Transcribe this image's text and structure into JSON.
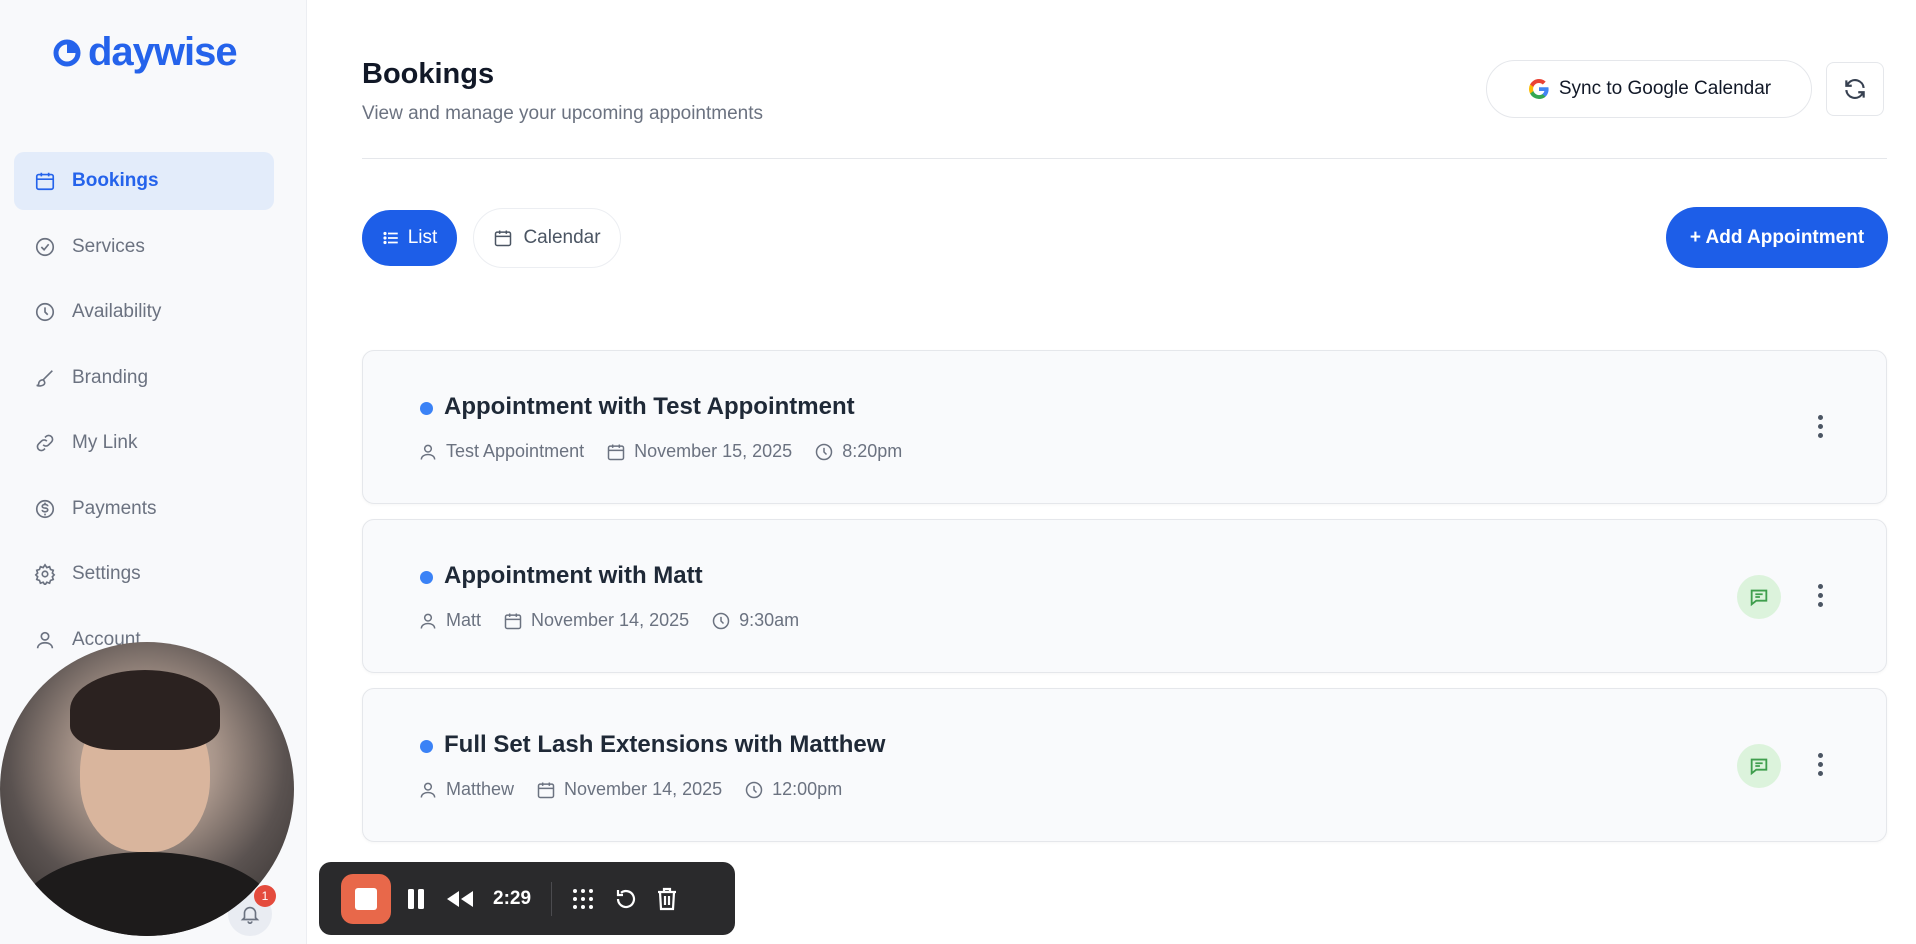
{
  "app": {
    "logo_text": "daywise"
  },
  "sidebar": {
    "items": [
      {
        "label": "Bookings",
        "icon": "calendar-icon",
        "active": true
      },
      {
        "label": "Services",
        "icon": "check-circle-icon"
      },
      {
        "label": "Availability",
        "icon": "clock-icon"
      },
      {
        "label": "Branding",
        "icon": "brush-icon"
      },
      {
        "label": "My Link",
        "icon": "link-icon"
      },
      {
        "label": "Payments",
        "icon": "dollar-icon"
      },
      {
        "label": "Settings",
        "icon": "gear-icon"
      },
      {
        "label": "Account",
        "icon": "user-icon"
      }
    ]
  },
  "header": {
    "title": "Bookings",
    "subtitle": "View and manage your upcoming appointments",
    "sync_label": "Sync to Google Calendar"
  },
  "view_tabs": {
    "list_label": "List",
    "calendar_label": "Calendar"
  },
  "add_button": {
    "label": "+ Add Appointment"
  },
  "appointments": [
    {
      "title": "Appointment with Test Appointment",
      "client": "Test Appointment",
      "date": "November 15, 2025",
      "time": "8:20pm",
      "has_message": false
    },
    {
      "title": "Appointment with Matt",
      "client": "Matt",
      "date": "November 14, 2025",
      "time": "9:30am",
      "has_message": true
    },
    {
      "title": "Full Set Lash Extensions with Matthew",
      "client": "Matthew",
      "date": "November 14, 2025",
      "time": "12:00pm",
      "has_message": true
    }
  ],
  "notifications": {
    "count": "1"
  },
  "recorder": {
    "time": "2:29"
  },
  "colors": {
    "accent": "#1d5ee8",
    "status_dot": "#3b82f6",
    "record": "#e8684a"
  }
}
